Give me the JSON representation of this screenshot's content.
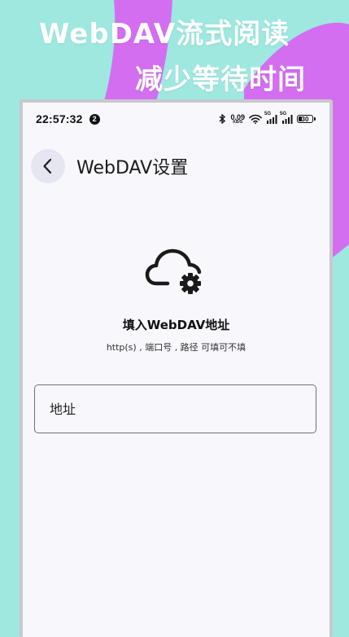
{
  "promo": {
    "line1": "WebDAV流式阅读",
    "line2": "减少等待时间"
  },
  "status_bar": {
    "time": "22:57:32",
    "notification_count": "2",
    "net_speed_value": "0.09",
    "net_speed_unit": "KB/S",
    "signal1_tag": "5G",
    "signal2_tag": "5G",
    "battery_level": "30"
  },
  "appbar": {
    "back_icon": "chevron-left-icon",
    "title": "WebDAV设置"
  },
  "main": {
    "icon": "cloud-gear-icon",
    "heading": "填入WebDAV地址",
    "subtext": "http(s) , 端口号 , 路径 可填可不填",
    "address_field": {
      "placeholder": "地址",
      "value": ""
    }
  },
  "colors": {
    "background": "#9ee8e0",
    "accent_blob": "#d46ef0",
    "screen_bg": "#f8f7fc",
    "back_button_bg": "#e6e6f2"
  }
}
